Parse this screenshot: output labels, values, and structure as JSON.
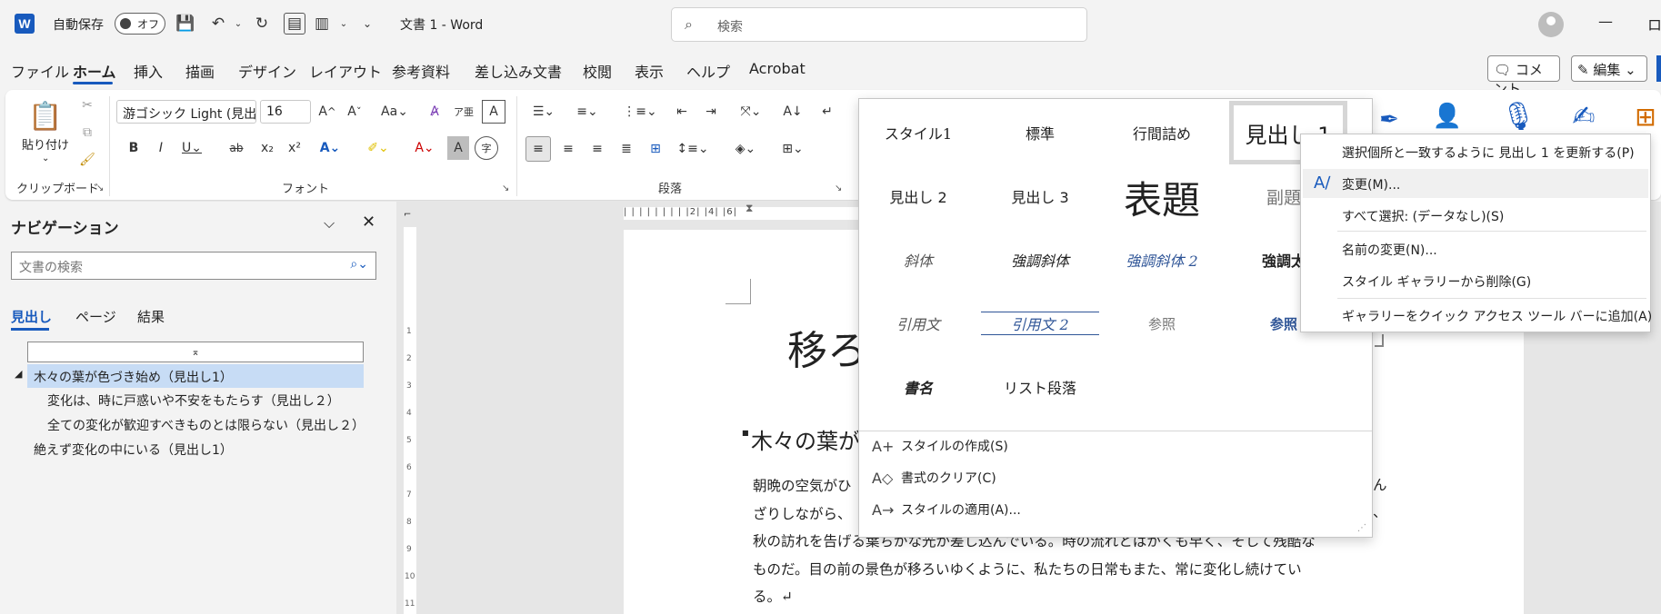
{
  "titlebar": {
    "app_logo": "W",
    "autosave_label": "自動保存",
    "autosave_state": "オフ",
    "doc_title": "文書 1  -  Word",
    "search_placeholder": "検索",
    "minimize": "—"
  },
  "menu": {
    "tabs": [
      "ファイル",
      "ホーム",
      "挿入",
      "描画",
      "デザイン",
      "レイアウト",
      "参考資料",
      "差し込み文書",
      "校閲",
      "表示",
      "ヘルプ",
      "Acrobat"
    ],
    "comment_label": "コメント",
    "edit_label": "編集"
  },
  "ribbon": {
    "paste_label": "貼り付け",
    "groups": {
      "clipboard": "クリップボード",
      "font": "フォント",
      "paragraph": "段落"
    },
    "font_name": "游ゴシック Light (見出",
    "font_size": "16",
    "font_buttons": {
      "grow": "A^",
      "shrink": "Aˇ",
      "case": "Aa",
      "bold": "B",
      "italic": "I",
      "underline": "U",
      "strike": "ab",
      "sub": "x₂",
      "sup": "x²"
    }
  },
  "nav": {
    "title": "ナビゲーション",
    "search_placeholder": "文書の検索",
    "tabs": [
      "見出し",
      "ページ",
      "結果"
    ],
    "headings": [
      {
        "text": "木々の葉が色づき始め（見出し1）"
      },
      {
        "text": "変化は、時に戸惑いや不安をもたらす（見出し２）"
      },
      {
        "text": "全ての変化が歓迎すべきものとは限らない（見出し２）"
      },
      {
        "text": "絶えず変化の中にいる（見出し1）"
      }
    ]
  },
  "rulers": {
    "horizontal_ticks": "| | | | | | | | |2| |4| |6|",
    "vertical_ticks": [
      "1",
      "2",
      "3",
      "4",
      "5",
      "6",
      "7",
      "8",
      "9",
      "10",
      "11"
    ]
  },
  "document": {
    "title_visible": "移ろ",
    "heading_visible": "木々の葉が",
    "para_lines": [
      "朝晩の空気がひ",
      "ざりしながら、",
      "秋の訪れを告げる葉ちがな光が差し込んでいる。時の流れとはかくも早く、そして残酷な",
      "ものだ。目の前の景色が移ろいゆくように、私たちの日常もまた、常に変化し続けてい",
      "る。↵"
    ],
    "para_right_fragments": [
      "ん",
      "、"
    ]
  },
  "gallery": {
    "styles": [
      "スタイル1",
      "標準",
      "行間詰め",
      "見出し 1",
      "見出し 2",
      "見出し 3",
      "表題",
      "副題",
      "斜体",
      "強調斜体",
      "強調斜体 2",
      "強調太",
      "引用文",
      "引用文 2",
      "参照",
      "参照",
      "書名",
      "リスト段落"
    ],
    "actions": [
      {
        "label": "スタイルの作成(S)",
        "icon": "A+"
      },
      {
        "label": "書式のクリア(C)",
        "icon": "A◇"
      },
      {
        "label": "スタイルの適用(A)...",
        "icon": "A→"
      }
    ]
  },
  "context_menu": {
    "items": [
      "選択個所と一致するように 見出し 1 を更新する(P)",
      "変更(M)...",
      "すべて選択: (データなし)(S)",
      "名前の変更(N)...",
      "スタイル ギャラリーから削除(G)",
      "ギャラリーをクイック アクセス ツール バーに追加(A)"
    ]
  },
  "colors": {
    "accent": "#185abd",
    "selected_heading": "#c7dcf5",
    "ribbon_bg": "#ffffff",
    "chrome_bg": "#f3f3f3"
  }
}
